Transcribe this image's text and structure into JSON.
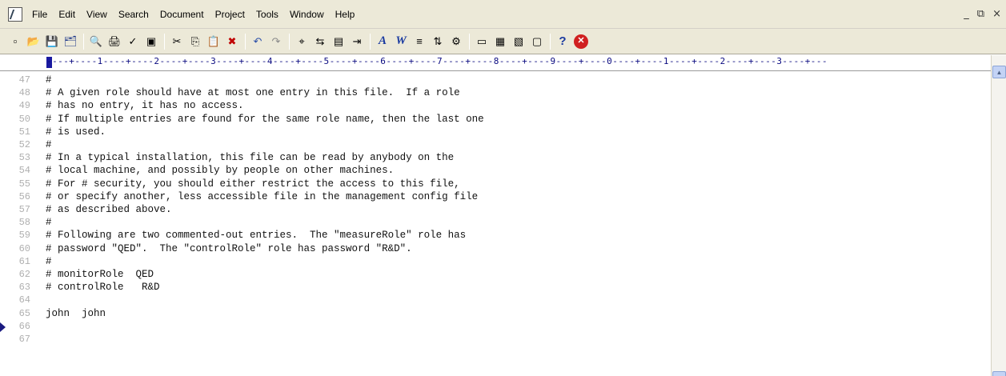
{
  "menu": {
    "items": [
      "File",
      "Edit",
      "View",
      "Search",
      "Document",
      "Project",
      "Tools",
      "Window",
      "Help"
    ]
  },
  "window_controls": {
    "minimize": "_",
    "restore": "⧉",
    "close": "×"
  },
  "toolbar": {
    "icons": [
      {
        "name": "new-file-icon",
        "glyph": "▫"
      },
      {
        "name": "open-folder-icon",
        "glyph": "📂"
      },
      {
        "name": "save-icon",
        "glyph": "💾"
      },
      {
        "name": "save-all-icon",
        "glyph": "🗂"
      },
      {
        "name": "print-preview-icon",
        "glyph": "🔍"
      },
      {
        "name": "print-icon",
        "glyph": "🖨"
      },
      {
        "name": "spellcheck-icon",
        "glyph": "✓"
      },
      {
        "name": "properties-icon",
        "glyph": "▣"
      },
      {
        "name": "cut-icon",
        "glyph": "✂"
      },
      {
        "name": "copy-icon",
        "glyph": "⎘"
      },
      {
        "name": "paste-icon",
        "glyph": "📋"
      },
      {
        "name": "delete-icon",
        "glyph": "✖"
      },
      {
        "name": "undo-icon",
        "glyph": "↶"
      },
      {
        "name": "redo-icon",
        "glyph": "↷"
      },
      {
        "name": "find-icon",
        "glyph": "⌖"
      },
      {
        "name": "replace-icon",
        "glyph": "⇆"
      },
      {
        "name": "document-icon",
        "glyph": "▤"
      },
      {
        "name": "indent-icon",
        "glyph": "⇥"
      },
      {
        "name": "font-icon",
        "glyph": "A"
      },
      {
        "name": "word-wrap-icon",
        "glyph": "W"
      },
      {
        "name": "align-icon",
        "glyph": "≡"
      },
      {
        "name": "sort-icon",
        "glyph": "⇅"
      },
      {
        "name": "toolbox-icon",
        "glyph": "⚙"
      },
      {
        "name": "view-a-icon",
        "glyph": "▭"
      },
      {
        "name": "view-b-icon",
        "glyph": "▦"
      },
      {
        "name": "view-c-icon",
        "glyph": "▧"
      },
      {
        "name": "view-d-icon",
        "glyph": "▢"
      },
      {
        "name": "context-help-icon",
        "glyph": "?"
      },
      {
        "name": "stop-icon",
        "glyph": "✕"
      }
    ],
    "separators_after": [
      3,
      7,
      11,
      13,
      17,
      22,
      26
    ]
  },
  "ruler": {
    "text": "----+----1----+----2----+----3----+----4----+----5----+----6----+----7----+----8----+----9----+----0----+----1----+----2----+----3----+---"
  },
  "editor": {
    "current_line": 66,
    "lines": [
      {
        "num": "47",
        "text": "#"
      },
      {
        "num": "48",
        "text": "# A given role should have at most one entry in this file.  If a role"
      },
      {
        "num": "49",
        "text": "# has no entry, it has no access."
      },
      {
        "num": "50",
        "text": "# If multiple entries are found for the same role name, then the last one"
      },
      {
        "num": "51",
        "text": "# is used."
      },
      {
        "num": "52",
        "text": "#"
      },
      {
        "num": "53",
        "text": "# In a typical installation, this file can be read by anybody on the"
      },
      {
        "num": "54",
        "text": "# local machine, and possibly by people on other machines."
      },
      {
        "num": "55",
        "text": "# For # security, you should either restrict the access to this file,"
      },
      {
        "num": "56",
        "text": "# or specify another, less accessible file in the management config file"
      },
      {
        "num": "57",
        "text": "# as described above."
      },
      {
        "num": "58",
        "text": "#"
      },
      {
        "num": "59",
        "text": "# Following are two commented-out entries.  The \"measureRole\" role has"
      },
      {
        "num": "60",
        "text": "# password \"QED\".  The \"controlRole\" role has password \"R&D\"."
      },
      {
        "num": "61",
        "text": "#"
      },
      {
        "num": "62",
        "text": "# monitorRole  QED"
      },
      {
        "num": "63",
        "text": "# controlRole   R&D"
      },
      {
        "num": "64",
        "text": ""
      },
      {
        "num": "65",
        "text": "john  john"
      },
      {
        "num": "66",
        "text": ""
      },
      {
        "num": "67",
        "text": ""
      }
    ]
  },
  "scrollbar": {
    "up_arrow": "▲"
  }
}
